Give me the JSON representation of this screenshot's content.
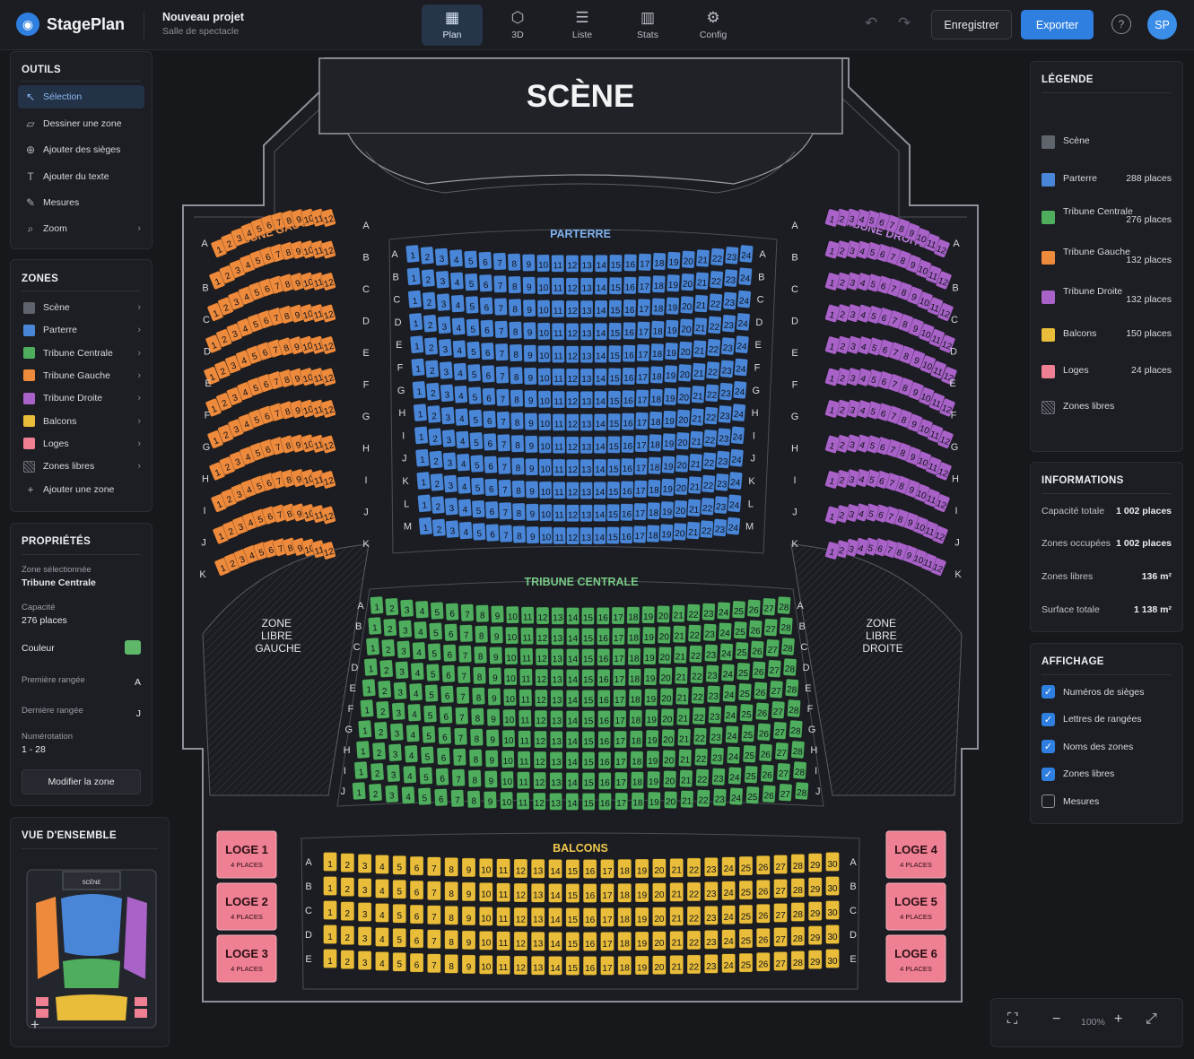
{
  "app": {
    "name": "StagePlan",
    "project_title": "Nouveau projet",
    "project_subtitle": "Salle de spectacle"
  },
  "nav_tabs": [
    {
      "label": "Plan",
      "icon": "map-icon"
    },
    {
      "label": "3D",
      "icon": "cube-icon"
    },
    {
      "label": "Liste",
      "icon": "list-icon"
    },
    {
      "label": "Stats",
      "icon": "bar-chart-icon"
    },
    {
      "label": "Config",
      "icon": "gear-icon"
    }
  ],
  "toolbar": {
    "save_label": "Enregistrer",
    "export_label": "Exporter",
    "avatar_initials": "SP",
    "help_glyph": "?"
  },
  "tools": {
    "title": "OUTILS",
    "items": [
      {
        "label": "Sélection",
        "icon": "cursor-icon"
      },
      {
        "label": "Dessiner une zone",
        "icon": "draw-zone-icon"
      },
      {
        "label": "Ajouter des sièges",
        "icon": "add-seats-icon"
      },
      {
        "label": "Ajouter du texte",
        "icon": "text-icon"
      },
      {
        "label": "Mesures",
        "icon": "ruler-icon"
      },
      {
        "label": "Zoom",
        "icon": "zoom-icon"
      }
    ]
  },
  "zones": {
    "title": "ZONES",
    "items": [
      {
        "label": "Scène",
        "color": "#5f636b"
      },
      {
        "label": "Parterre",
        "color": "#4a86d8"
      },
      {
        "label": "Tribune Centrale",
        "color": "#4fae5e"
      },
      {
        "label": "Tribune Gauche",
        "color": "#ee8a3c"
      },
      {
        "label": "Tribune Droite",
        "color": "#a862c8"
      },
      {
        "label": "Balcons",
        "color": "#e9bd3a"
      },
      {
        "label": "Loges",
        "color": "#ef7f92"
      },
      {
        "label": "Zones libres",
        "color": "hatch"
      }
    ],
    "add_label": "Ajouter une zone"
  },
  "properties": {
    "title": "PROPRIÉTÉS",
    "selected_label": "Zone sélectionnée",
    "selected_value": "Tribune Centrale",
    "capacity_label": "Capacité",
    "capacity_value": "276 places",
    "color_label": "Couleur",
    "color_value": "#5fb86a",
    "first_row_label": "Première rangée",
    "first_row_value": "A",
    "last_row_label": "Dernière rangée",
    "last_row_value": "J",
    "numbering_label": "Numérotation",
    "numbering_value": "1 - 28",
    "edit_button": "Modifier la zone"
  },
  "overview": {
    "title": "VUE D'ENSEMBLE",
    "stage_label": "SCÈNE",
    "add_glyph": "+"
  },
  "legend": {
    "title": "LÉGENDE",
    "items": [
      {
        "name": "Scène",
        "count": "",
        "color": "#5f636b"
      },
      {
        "name": "Parterre",
        "count": "288 places",
        "color": "#4a86d8"
      },
      {
        "name": "Tribune Centrale",
        "count": "276 places",
        "color": "#4fae5e"
      },
      {
        "name": "Tribune Gauche",
        "count": "132 places",
        "color": "#ee8a3c"
      },
      {
        "name": "Tribune Droite",
        "count": "132 places",
        "color": "#a862c8"
      },
      {
        "name": "Balcons",
        "count": "150 places",
        "color": "#e9bd3a"
      },
      {
        "name": "Loges",
        "count": "24 places",
        "color": "#ef7f92"
      },
      {
        "name": "Zones libres",
        "count": "",
        "color": "hatch"
      }
    ]
  },
  "info": {
    "title": "INFORMATIONS",
    "rows": [
      {
        "label": "Capacité totale",
        "value": "1 002 places"
      },
      {
        "label": "Zones occupées",
        "value": "1 002 places"
      },
      {
        "label": "Zones libres",
        "value": "136 m²"
      },
      {
        "label": "Surface totale",
        "value": "1 138 m²"
      }
    ]
  },
  "display": {
    "title": "AFFICHAGE",
    "options": [
      {
        "label": "Numéros de sièges",
        "checked": true
      },
      {
        "label": "Lettres de rangées",
        "checked": true
      },
      {
        "label": "Noms des zones",
        "checked": true
      },
      {
        "label": "Zones libres",
        "checked": true
      },
      {
        "label": "Mesures",
        "checked": false
      }
    ]
  },
  "plan": {
    "stage_label": "SCÈNE",
    "parterre_label": "PARTERRE",
    "tribune_centrale_label": "TRIBUNE CENTRALE",
    "tribune_gauche_label": "TRIBUNE GAUCHE",
    "tribune_droite_label": "TRIBUNE DROITE",
    "balcons_label": "BALCONS",
    "free_left_label": [
      "ZONE",
      "LIBRE",
      "GAUCHE"
    ],
    "free_right_label": [
      "ZONE",
      "LIBRE",
      "DROITE"
    ],
    "parterre_rows": [
      "A",
      "B",
      "C",
      "D",
      "E",
      "F",
      "G",
      "H",
      "I",
      "J",
      "K",
      "L",
      "M"
    ],
    "parterre_seats_per_row": 24,
    "centrale_rows": [
      "A",
      "B",
      "C",
      "D",
      "E",
      "F",
      "G",
      "H",
      "I",
      "J"
    ],
    "centrale_seats_per_row": 28,
    "side_rows": [
      "A",
      "B",
      "C",
      "D",
      "E",
      "F",
      "G",
      "H",
      "I",
      "J",
      "K"
    ],
    "side_seats_per_row": 12,
    "balcon_rows": [
      "A",
      "B",
      "C",
      "D",
      "E"
    ],
    "balcon_seats_per_row": 30,
    "loges": [
      {
        "name": "LOGE 1",
        "places": "4 PLACES"
      },
      {
        "name": "LOGE 2",
        "places": "4 PLACES"
      },
      {
        "name": "LOGE 3",
        "places": "4 PLACES"
      },
      {
        "name": "LOGE 4",
        "places": "4 PLACES"
      },
      {
        "name": "LOGE 5",
        "places": "4 PLACES"
      },
      {
        "name": "LOGE 6",
        "places": "4 PLACES"
      }
    ]
  },
  "zoom": {
    "level": "100%"
  }
}
